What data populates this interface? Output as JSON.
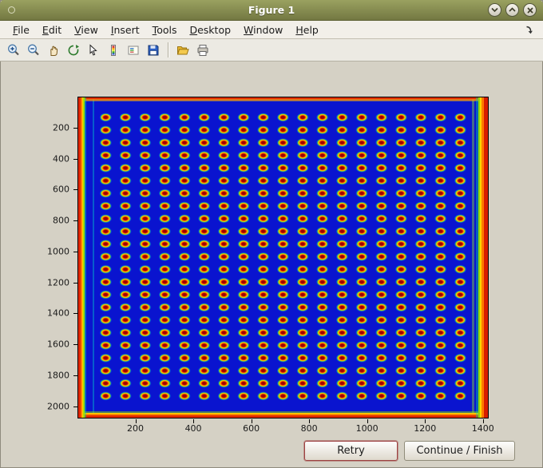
{
  "window": {
    "title": "Figure 1",
    "controls": [
      "shade",
      "maximize",
      "close"
    ]
  },
  "menu": {
    "items": [
      "File",
      "Edit",
      "View",
      "Insert",
      "Tools",
      "Desktop",
      "Window",
      "Help"
    ]
  },
  "toolbar": {
    "icons": [
      "zoom-in",
      "zoom-out",
      "pan-hand",
      "rotate-3d",
      "data-cursor",
      "colorbar",
      "legend",
      "save",
      "open-folder",
      "print"
    ]
  },
  "plot": {
    "type": "image-heatmap",
    "description": "Blue field with regular grid of red/orange spots (about 19 columns by 23 rows) and red-orange saturated borders on all four edges, jet colormap",
    "x_ticks": [
      200,
      400,
      600,
      800,
      1000,
      1200,
      1400
    ],
    "y_ticks": [
      200,
      400,
      600,
      800,
      1000,
      1200,
      1400,
      1600,
      1800,
      2000
    ],
    "x_range": [
      0,
      1420
    ],
    "y_range": [
      0,
      2080
    ]
  },
  "buttons": {
    "retry": "Retry",
    "continue_finish": "Continue / Finish"
  }
}
